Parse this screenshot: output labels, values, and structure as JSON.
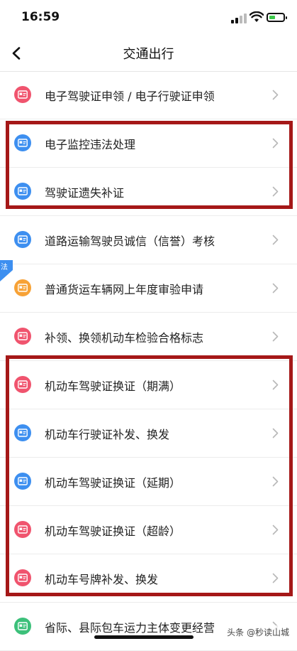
{
  "status_bar": {
    "time": "16:59"
  },
  "nav": {
    "title": "交通出行"
  },
  "items": [
    {
      "label": "电子驾驶证申领 / 电子行驶证申领",
      "color": "#f0546e"
    },
    {
      "label": "电子监控违法处理",
      "color": "#3d8ff0"
    },
    {
      "label": "驾驶证遗失补证",
      "color": "#3d8ff0"
    },
    {
      "label": "道路运输驾驶员诚信（信誉）考核",
      "color": "#3d8ff0"
    },
    {
      "label": "普通货运车辆网上年度审验申请",
      "color": "#f7a236"
    },
    {
      "label": "补领、换领机动车检验合格标志",
      "color": "#f0546e"
    },
    {
      "label": "机动车驾驶证换证（期满）",
      "color": "#f0546e"
    },
    {
      "label": "机动车行驶证补发、换发",
      "color": "#3d8ff0"
    },
    {
      "label": "机动车驾驶证换证（延期）",
      "color": "#3d8ff0"
    },
    {
      "label": "机动车驾驶证换证（超龄）",
      "color": "#f0546e"
    },
    {
      "label": "机动车号牌补发、换发",
      "color": "#f0546e"
    },
    {
      "label": "省际、县际包车运力主体变更经营",
      "color": "#3cc07a"
    }
  ],
  "side_tag": {
    "text": "法"
  },
  "watermark": "头条 @秒读山城",
  "colors": {
    "highlight": "#a51818",
    "chevron": "#b8b8b8"
  }
}
